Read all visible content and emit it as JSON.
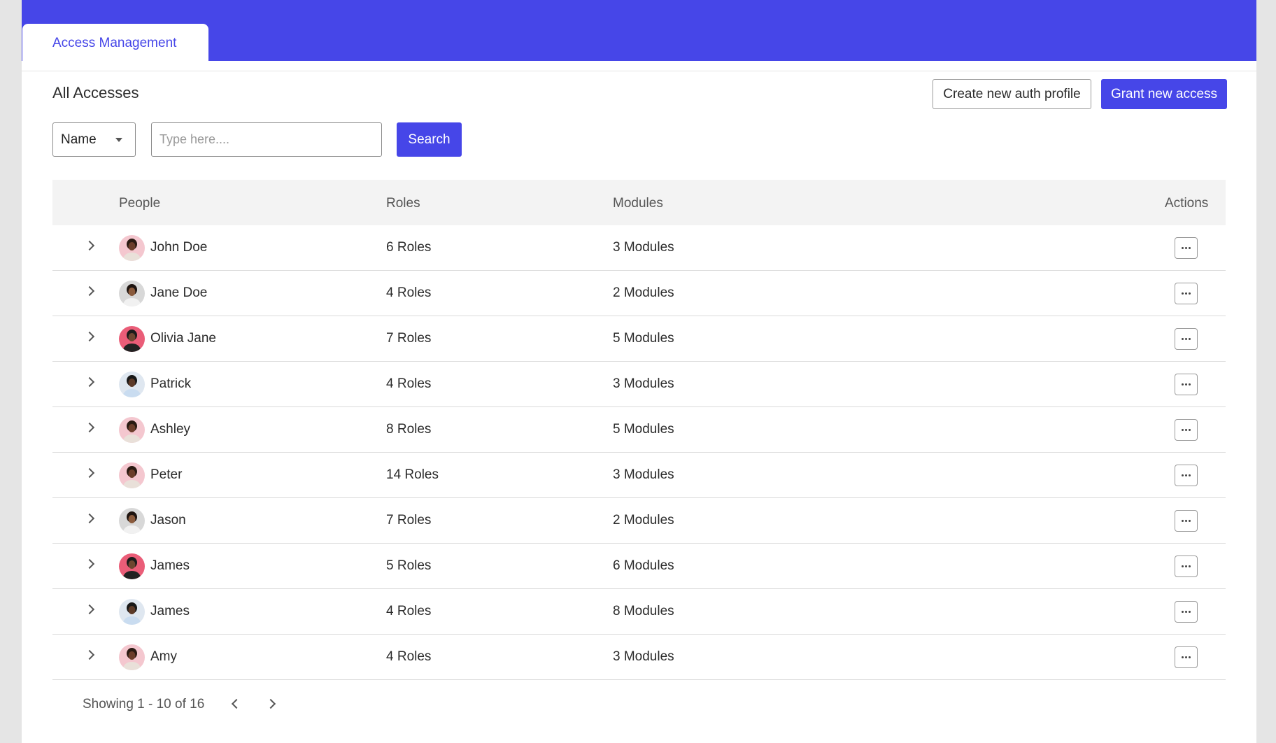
{
  "tabs": {
    "active_label": "Access Management"
  },
  "section": {
    "title": "All Accesses"
  },
  "actions": {
    "create_auth_profile": "Create new auth profile",
    "grant_access": "Grant new access"
  },
  "filter": {
    "selected_field": "Name",
    "search_placeholder": "Type here....",
    "search_button": "Search"
  },
  "table": {
    "headers": {
      "people": "People",
      "roles": "Roles",
      "modules": "Modules",
      "actions": "Actions"
    },
    "rows": [
      {
        "name": "John Doe",
        "roles": "6 Roles",
        "modules": "3 Modules",
        "avatar": "woman-pink"
      },
      {
        "name": "Jane Doe",
        "roles": "4 Roles",
        "modules": "2 Modules",
        "avatar": "woman-grey"
      },
      {
        "name": "Olivia Jane",
        "roles": "7 Roles",
        "modules": "5 Modules",
        "avatar": "man-red"
      },
      {
        "name": "Patrick",
        "roles": "4 Roles",
        "modules": "3 Modules",
        "avatar": "man-blue"
      },
      {
        "name": "Ashley",
        "roles": "8 Roles",
        "modules": "5 Modules",
        "avatar": "woman-pink"
      },
      {
        "name": "Peter",
        "roles": "14 Roles",
        "modules": "3 Modules",
        "avatar": "woman-pink"
      },
      {
        "name": "Jason",
        "roles": "7 Roles",
        "modules": "2 Modules",
        "avatar": "woman-grey"
      },
      {
        "name": "James",
        "roles": "5 Roles",
        "modules": "6 Modules",
        "avatar": "man-red"
      },
      {
        "name": "James",
        "roles": "4 Roles",
        "modules": "8 Modules",
        "avatar": "man-blue"
      },
      {
        "name": "Amy",
        "roles": "4 Roles",
        "modules": "3 Modules",
        "avatar": "woman-pink"
      }
    ]
  },
  "pagination": {
    "summary": "Showing 1 - 10 of 16"
  },
  "colors": {
    "brand": "#4646e8"
  }
}
